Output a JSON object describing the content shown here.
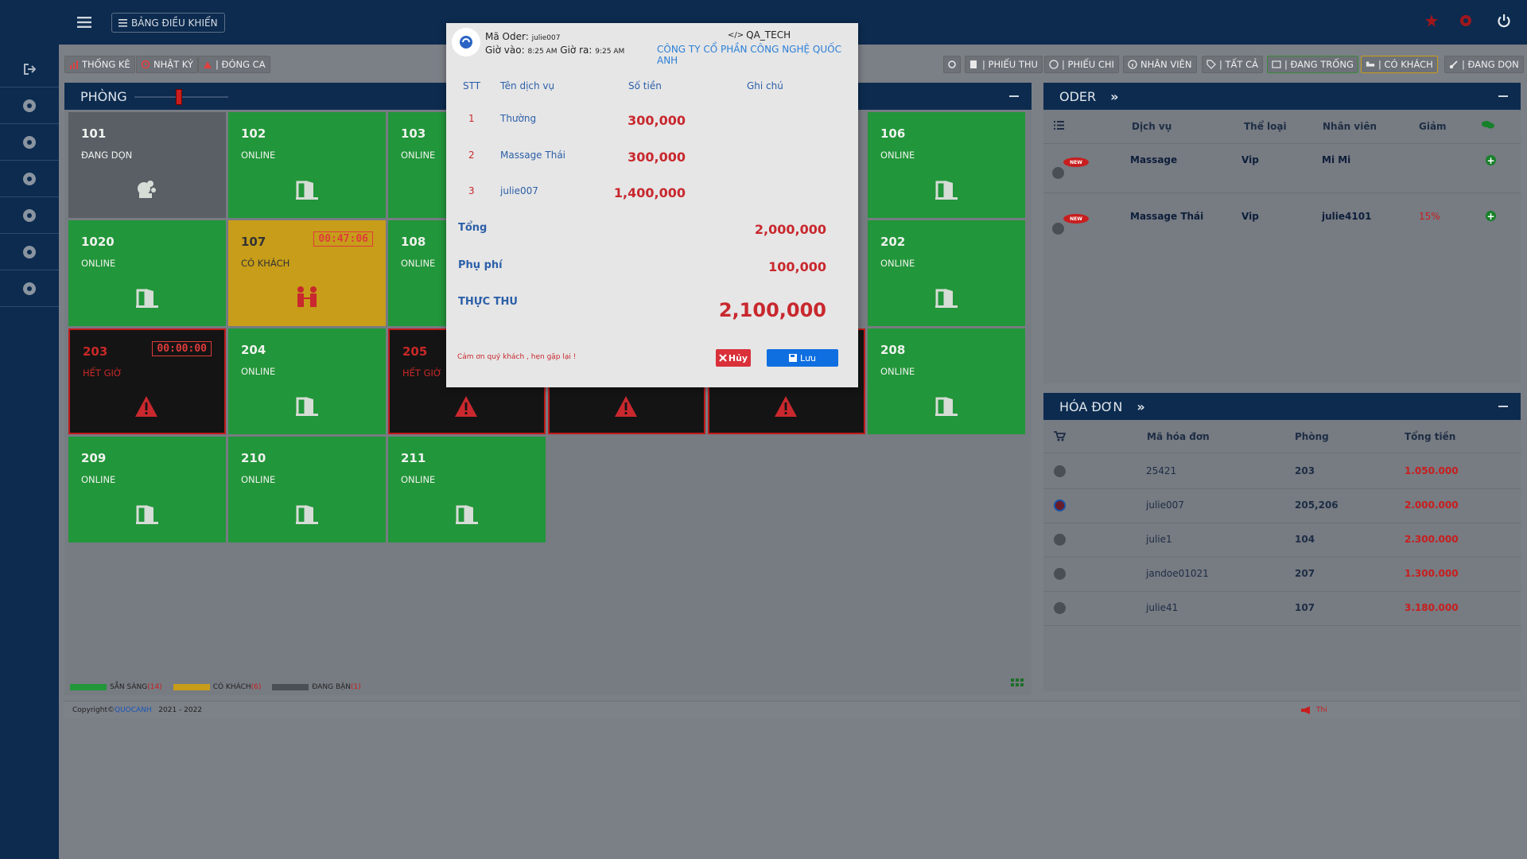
{
  "header": {
    "dashboard_label": "BẢNG ĐIỀU KHIỂN"
  },
  "toolbar_left": [
    "THỐNG KÊ",
    "NHẬT KÝ",
    "| ĐÓNG CA"
  ],
  "toolbar_right": [
    "| PHIẾU THU",
    "| PHIẾU CHI",
    "NHÂN VIÊN",
    "| TẤT CẢ",
    "| ĐANG TRỐNG",
    "| CÓ KHÁCH",
    "| ĐANG DỌN"
  ],
  "rooms_panel": {
    "title": "PHÒNG",
    "rooms": [
      {
        "num": "101",
        "status": "ĐANG DỌN",
        "kind": "cleaning"
      },
      {
        "num": "102",
        "status": "ONLINE",
        "kind": "online"
      },
      {
        "num": "103",
        "status": "ONLINE",
        "kind": "online"
      },
      {
        "num": "106",
        "status": "ONLINE",
        "kind": "online"
      },
      {
        "num": "1020",
        "status": "ONLINE",
        "kind": "online"
      },
      {
        "num": "107",
        "status": "CÓ KHÁCH",
        "kind": "busy",
        "timer": "00:47:06"
      },
      {
        "num": "108",
        "status": "ONLINE",
        "kind": "online"
      },
      {
        "num": "202",
        "status": "ONLINE",
        "kind": "online"
      },
      {
        "num": "203",
        "status": "HẾT GIỜ",
        "kind": "expired",
        "timer": "00:00:00"
      },
      {
        "num": "204",
        "status": "ONLINE",
        "kind": "online"
      },
      {
        "num": "205",
        "status": "HẾT GIỜ",
        "kind": "expired"
      },
      {
        "num": "",
        "status": "",
        "kind": "expired"
      },
      {
        "num": "",
        "status": "",
        "kind": "expired"
      },
      {
        "num": "208",
        "status": "ONLINE",
        "kind": "online"
      },
      {
        "num": "209",
        "status": "ONLINE",
        "kind": "online"
      },
      {
        "num": "210",
        "status": "ONLINE",
        "kind": "online"
      },
      {
        "num": "211",
        "status": "ONLINE",
        "kind": "online"
      }
    ]
  },
  "legend": {
    "ready_label": "SẴN SÀNG",
    "ready_count": "(14)",
    "busy_label": "CÓ KHÁCH",
    "busy_count": "(6)",
    "cleaning_label": "ĐANG BẬN",
    "cleaning_count": "(1)"
  },
  "colors": {
    "ready": "#22963a",
    "busy": "#c79d19",
    "cleaning": "#5a5f66",
    "expired_border": "#c01a1a"
  },
  "footer": {
    "copyright": "Copyright©",
    "brand": "QUOCANH",
    "years": "2021 - 2022",
    "notice": "Thi"
  },
  "oder_panel": {
    "title": "ODER",
    "columns": [
      "Dịch vụ",
      "Thể loại",
      "Nhân viên",
      "Giảm"
    ],
    "rows": [
      {
        "service": "Massage",
        "type": "Vip",
        "staff": "Mi Mi",
        "discount": ""
      },
      {
        "service": "Massage Thái",
        "type": "Vip",
        "staff": "julie4101",
        "discount": "15%"
      }
    ],
    "badge": "NEW"
  },
  "invoice_panel": {
    "title": "HÓA ĐƠN",
    "columns": [
      "Mã hóa đơn",
      "Phòng",
      "Tổng tiền"
    ],
    "rows": [
      {
        "code": "25421",
        "room": "203",
        "total": "1.050.000"
      },
      {
        "code": "julie007",
        "room": "205,206",
        "total": "2.000.000"
      },
      {
        "code": "julie1",
        "room": "104",
        "total": "2.300.000"
      },
      {
        "code": "jandoe01021",
        "room": "207",
        "total": "1.300.000"
      },
      {
        "code": "julie41",
        "room": "107",
        "total": "3.180.000"
      }
    ]
  },
  "modal": {
    "order_label": "Mã Oder:",
    "order_code": "julie007",
    "checkin_label": "Giờ vào:",
    "checkin_time": "8:25 AM",
    "checkout_label": "Giờ ra:",
    "checkout_time": "9:25 AM",
    "brand": "QA_TECH",
    "company": "CÔNG TY CỔ PHẦN CÔNG NGHỆ QUỐC ANH",
    "columns": [
      "STT",
      "Tên dịch vụ",
      "Số tiền",
      "Ghi chú"
    ],
    "items": [
      {
        "stt": "1",
        "name": "Thường",
        "amount": "300,000",
        "note": ""
      },
      {
        "stt": "2",
        "name": "Massage Thái",
        "amount": "300,000",
        "note": ""
      },
      {
        "stt": "3",
        "name": "julie007",
        "amount": "1,400,000",
        "note": ""
      }
    ],
    "total_label": "Tổng",
    "total_value": "2,000,000",
    "fee_label": "Phụ phí",
    "fee_value": "100,000",
    "net_label": "THỰC THU",
    "net_value": "2,100,000",
    "thanks": "Cảm ơn quý khách , hẹn gặp lại !",
    "cancel_label": "Hủy",
    "save_label": "Lưu"
  }
}
